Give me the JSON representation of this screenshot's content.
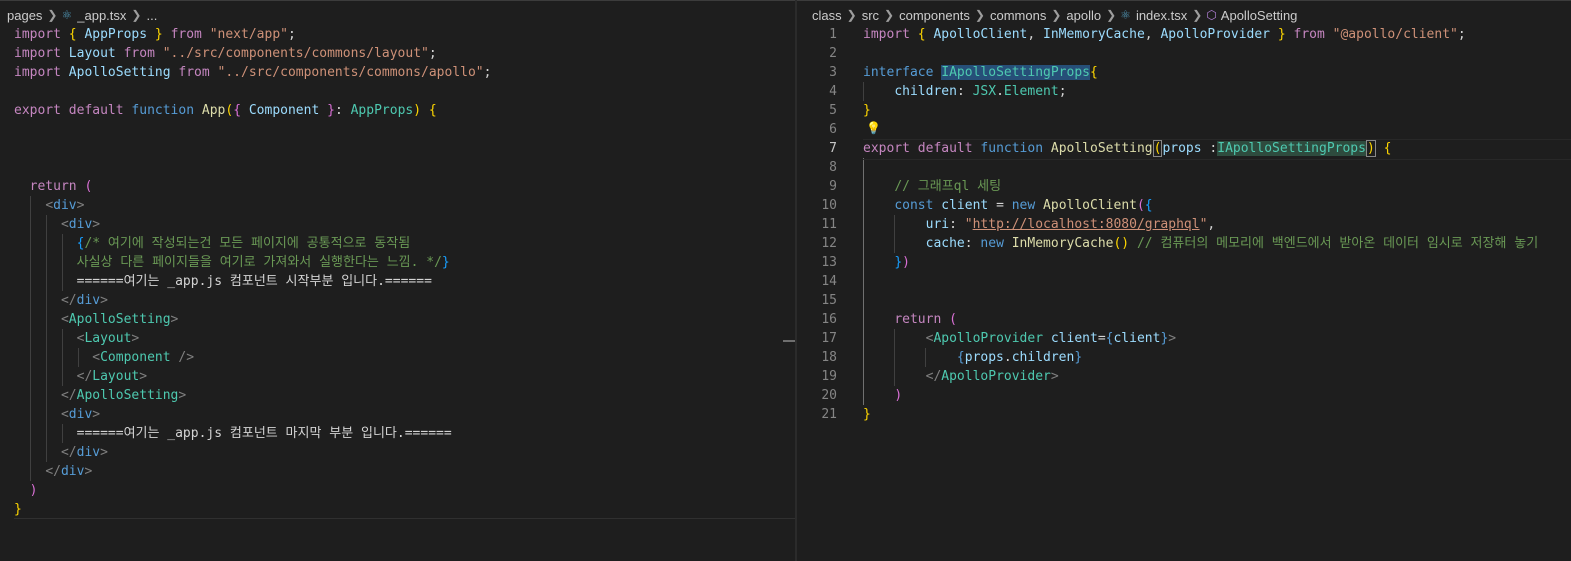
{
  "left_pane": {
    "breadcrumb": [
      "pages",
      "_app.tsx",
      "..."
    ],
    "lines": [
      [
        [
          "k",
          "import"
        ],
        [
          "p",
          " "
        ],
        [
          "b1",
          "{"
        ],
        [
          "p",
          " "
        ],
        [
          "v",
          "AppProps"
        ],
        [
          "p",
          " "
        ],
        [
          "b1",
          "}"
        ],
        [
          "p",
          " "
        ],
        [
          "k",
          "from"
        ],
        [
          "p",
          " "
        ],
        [
          "s",
          "\"next/app\""
        ],
        [
          "p",
          ";"
        ]
      ],
      [
        [
          "k",
          "import"
        ],
        [
          "p",
          " "
        ],
        [
          "v",
          "Layout"
        ],
        [
          "p",
          " "
        ],
        [
          "k",
          "from"
        ],
        [
          "p",
          " "
        ],
        [
          "s",
          "\"../src/components/commons/layout\""
        ],
        [
          "p",
          ";"
        ]
      ],
      [
        [
          "k",
          "import"
        ],
        [
          "p",
          " "
        ],
        [
          "v",
          "ApolloSetting"
        ],
        [
          "p",
          " "
        ],
        [
          "k",
          "from"
        ],
        [
          "p",
          " "
        ],
        [
          "s",
          "\"../src/components/commons/apollo\""
        ],
        [
          "p",
          ";"
        ]
      ],
      [],
      [
        [
          "k",
          "export"
        ],
        [
          "p",
          " "
        ],
        [
          "k",
          "default"
        ],
        [
          "p",
          " "
        ],
        [
          "kw",
          "function"
        ],
        [
          "p",
          " "
        ],
        [
          "f",
          "App"
        ],
        [
          "b1",
          "("
        ],
        [
          "b2",
          "{"
        ],
        [
          "p",
          " "
        ],
        [
          "v",
          "Component"
        ],
        [
          "p",
          " "
        ],
        [
          "b2",
          "}"
        ],
        [
          "p",
          ": "
        ],
        [
          "t",
          "AppProps"
        ],
        [
          "b1",
          ")"
        ],
        [
          "p",
          " "
        ],
        [
          "b1",
          "{"
        ]
      ],
      [],
      [],
      [],
      [
        [
          "p",
          "  "
        ],
        [
          "k",
          "return"
        ],
        [
          "p",
          " "
        ],
        [
          "b2",
          "("
        ]
      ],
      [
        [
          "p",
          "    "
        ],
        [
          "tag",
          "<"
        ],
        [
          "kw",
          "div"
        ],
        [
          "tag",
          ">"
        ]
      ],
      [
        [
          "p",
          "      "
        ],
        [
          "tag",
          "<"
        ],
        [
          "kw",
          "div"
        ],
        [
          "tag",
          ">"
        ]
      ],
      [
        [
          "p",
          "        "
        ],
        [
          "b3",
          "{"
        ],
        [
          "c",
          "/* 여기에 작성되는건 모든 페이지에 공통적으로 동작됨"
        ]
      ],
      [
        [
          "c",
          "        사실상 다른 페이지들을 여기로 가져와서 실행한다는 느낌. */"
        ],
        [
          "b3",
          "}"
        ]
      ],
      [
        [
          "p",
          "        ======여기는 _app.js 컴포넌트 시작부분 입니다.======"
        ]
      ],
      [
        [
          "p",
          "      "
        ],
        [
          "tag",
          "</"
        ],
        [
          "kw",
          "div"
        ],
        [
          "tag",
          ">"
        ]
      ],
      [
        [
          "p",
          "      "
        ],
        [
          "tag",
          "<"
        ],
        [
          "t",
          "ApolloSetting"
        ],
        [
          "tag",
          ">"
        ]
      ],
      [
        [
          "p",
          "        "
        ],
        [
          "tag",
          "<"
        ],
        [
          "t",
          "Layout"
        ],
        [
          "tag",
          ">"
        ]
      ],
      [
        [
          "p",
          "          "
        ],
        [
          "tag",
          "<"
        ],
        [
          "t",
          "Component"
        ],
        [
          "p",
          " "
        ],
        [
          "tag",
          "/>"
        ]
      ],
      [
        [
          "p",
          "        "
        ],
        [
          "tag",
          "</"
        ],
        [
          "t",
          "Layout"
        ],
        [
          "tag",
          ">"
        ]
      ],
      [
        [
          "p",
          "      "
        ],
        [
          "tag",
          "</"
        ],
        [
          "t",
          "ApolloSetting"
        ],
        [
          "tag",
          ">"
        ]
      ],
      [
        [
          "p",
          "      "
        ],
        [
          "tag",
          "<"
        ],
        [
          "kw",
          "div"
        ],
        [
          "tag",
          ">"
        ]
      ],
      [
        [
          "p",
          "        ======여기는 _app.js 컴포넌트 마지막 부분 입니다.======"
        ]
      ],
      [
        [
          "p",
          "      "
        ],
        [
          "tag",
          "</"
        ],
        [
          "kw",
          "div"
        ],
        [
          "tag",
          ">"
        ]
      ],
      [
        [
          "p",
          "    "
        ],
        [
          "tag",
          "</"
        ],
        [
          "kw",
          "div"
        ],
        [
          "tag",
          ">"
        ]
      ],
      [
        [
          "p",
          "  "
        ],
        [
          "b2",
          ")"
        ]
      ],
      [
        [
          "b1",
          "}"
        ]
      ]
    ]
  },
  "right_pane": {
    "breadcrumb": [
      "class",
      "src",
      "components",
      "commons",
      "apollo",
      "index.tsx",
      "ApolloSetting"
    ],
    "active_line": 7,
    "lines": [
      [
        [
          "k",
          "import"
        ],
        [
          "p",
          " "
        ],
        [
          "b1",
          "{"
        ],
        [
          "p",
          " "
        ],
        [
          "v",
          "ApolloClient"
        ],
        [
          "p",
          ", "
        ],
        [
          "v",
          "InMemoryCache"
        ],
        [
          "p",
          ", "
        ],
        [
          "v",
          "ApolloProvider"
        ],
        [
          "p",
          " "
        ],
        [
          "b1",
          "}"
        ],
        [
          "p",
          " "
        ],
        [
          "k",
          "from"
        ],
        [
          "p",
          " "
        ],
        [
          "s",
          "\"@apollo/client\""
        ],
        [
          "p",
          ";"
        ]
      ],
      [],
      [
        [
          "kw",
          "interface"
        ],
        [
          "p",
          " "
        ],
        [
          "t",
          "IApolloSettingProps",
          "hl-sel"
        ],
        [
          "b1",
          "{"
        ]
      ],
      [
        [
          "p",
          "    "
        ],
        [
          "v",
          "children"
        ],
        [
          "p",
          ": "
        ],
        [
          "t",
          "JSX"
        ],
        [
          "p",
          "."
        ],
        [
          "t",
          "Element"
        ],
        [
          "p",
          ";"
        ]
      ],
      [
        [
          "b1",
          "}"
        ]
      ],
      [],
      [
        [
          "k",
          "export"
        ],
        [
          "p",
          " "
        ],
        [
          "k",
          "default"
        ],
        [
          "p",
          " "
        ],
        [
          "kw",
          "function"
        ],
        [
          "p",
          " "
        ],
        [
          "f",
          "ApolloSetting"
        ],
        [
          "b1",
          "(",
          "hl-bracket"
        ],
        [
          "v",
          "props"
        ],
        [
          "p",
          " :"
        ],
        [
          "t",
          "IApolloSettingProps",
          "hl-type"
        ],
        [
          "b1",
          ")",
          "hl-bracket"
        ],
        [
          "p",
          " "
        ],
        [
          "b1",
          "{"
        ]
      ],
      [],
      [
        [
          "p",
          "    "
        ],
        [
          "c",
          "// 그래프ql 세팅"
        ]
      ],
      [
        [
          "p",
          "    "
        ],
        [
          "kw",
          "const"
        ],
        [
          "p",
          " "
        ],
        [
          "v",
          "client"
        ],
        [
          "p",
          " = "
        ],
        [
          "kw",
          "new"
        ],
        [
          "p",
          " "
        ],
        [
          "f",
          "ApolloClient"
        ],
        [
          "b2",
          "("
        ],
        [
          "b3",
          "{"
        ]
      ],
      [
        [
          "p",
          "        "
        ],
        [
          "v",
          "uri"
        ],
        [
          "p",
          ": "
        ],
        [
          "s",
          "\""
        ],
        [
          "url",
          "http://localhost:8080/graphql"
        ],
        [
          "s",
          "\""
        ],
        [
          "p",
          ","
        ]
      ],
      [
        [
          "p",
          "        "
        ],
        [
          "v",
          "cache"
        ],
        [
          "p",
          ": "
        ],
        [
          "kw",
          "new"
        ],
        [
          "p",
          " "
        ],
        [
          "f",
          "InMemoryCache"
        ],
        [
          "b1",
          "()"
        ],
        [
          "p",
          " "
        ],
        [
          "c",
          "// 컴퓨터의 메모리에 백엔드에서 받아온 데이터 임시로 저장해 놓기"
        ]
      ],
      [
        [
          "p",
          "    "
        ],
        [
          "b3",
          "}"
        ],
        [
          "b2",
          ")"
        ]
      ],
      [],
      [],
      [
        [
          "p",
          "    "
        ],
        [
          "k",
          "return"
        ],
        [
          "p",
          " "
        ],
        [
          "b2",
          "("
        ]
      ],
      [
        [
          "p",
          "        "
        ],
        [
          "tag",
          "<"
        ],
        [
          "t",
          "ApolloProvider"
        ],
        [
          "p",
          " "
        ],
        [
          "v",
          "client"
        ],
        [
          "p",
          "="
        ],
        [
          "kw",
          "{"
        ],
        [
          "v",
          "client"
        ],
        [
          "kw",
          "}"
        ],
        [
          "tag",
          ">"
        ]
      ],
      [
        [
          "p",
          "            "
        ],
        [
          "kw",
          "{"
        ],
        [
          "v",
          "props"
        ],
        [
          "p",
          "."
        ],
        [
          "v",
          "children"
        ],
        [
          "kw",
          "}"
        ]
      ],
      [
        [
          "p",
          "        "
        ],
        [
          "tag",
          "</"
        ],
        [
          "t",
          "ApolloProvider"
        ],
        [
          "tag",
          ">"
        ]
      ],
      [
        [
          "p",
          "    "
        ],
        [
          "b2",
          ")"
        ]
      ],
      [
        [
          "b1",
          "}"
        ]
      ]
    ]
  }
}
